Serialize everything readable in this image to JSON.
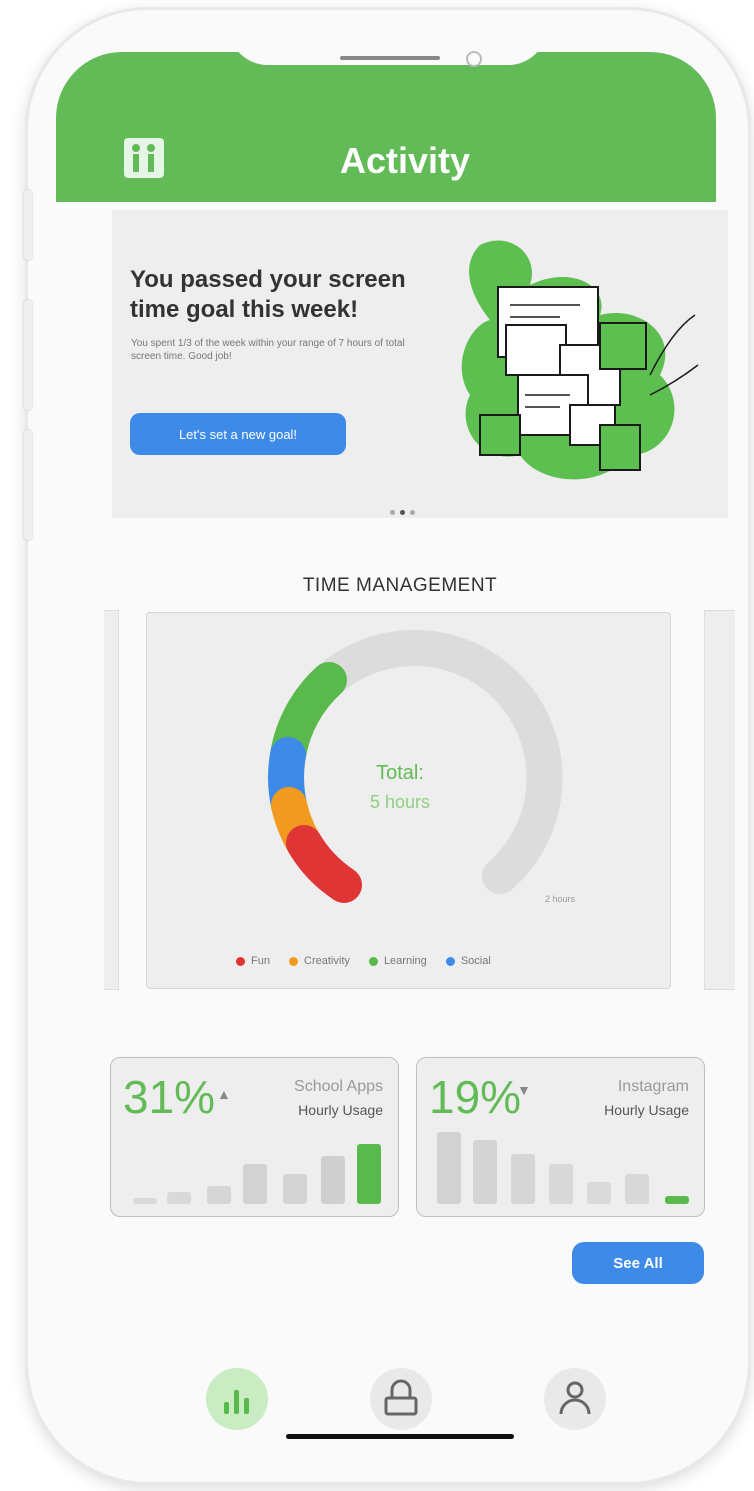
{
  "header": {
    "title": "Activity",
    "color": "#62bb56"
  },
  "banner": {
    "title": "You passed your screen time goal this week!",
    "subtitle": "You spent 1/3 of the week within your range of 7 hours of total screen time. Good job!",
    "button_label": "Let's set a new goal!",
    "pager": {
      "count": 3,
      "active": 1
    }
  },
  "time_management": {
    "title": "TIME MANAGEMENT",
    "total_label": "Total:",
    "total_value": "5 hours",
    "remaining_label": "2 hours",
    "legend": [
      {
        "label": "Fun",
        "color": "#e03535"
      },
      {
        "label": "Creativity",
        "color": "#f29a1f"
      },
      {
        "label": "Learning",
        "color": "#5ab94c"
      },
      {
        "label": "Social",
        "color": "#3d8ae8"
      }
    ]
  },
  "stats": [
    {
      "percent": "31%",
      "arrow": "▲",
      "app": "School Apps",
      "label": "Hourly Usage"
    },
    {
      "percent": "19%",
      "arrow": "▼",
      "app": "Instagram",
      "label": "Hourly Usage"
    }
  ],
  "see_all_label": "See All",
  "nav": {
    "items": [
      "activity-icon",
      "lock-icon",
      "profile-icon"
    ],
    "active": 0
  }
}
